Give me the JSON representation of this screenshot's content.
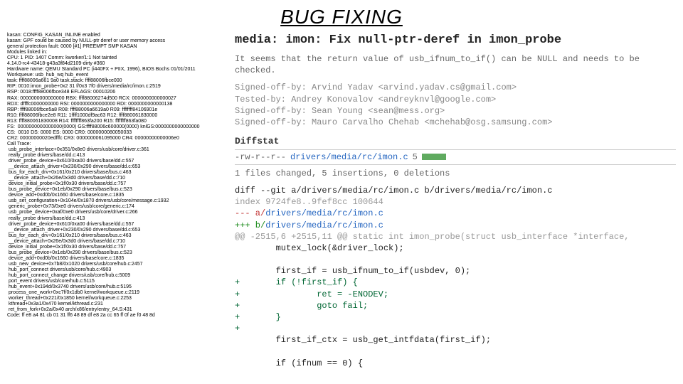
{
  "title": "BUG FIXING",
  "left_panel": "kasan: CONFIG_KASAN_INLINE enabled\nkasan: GPF could be caused by NULL-ptr deref or user memory access\ngeneral protection fault: 0000 [#1] PREEMPT SMP KASAN\nModules linked in:\nCPU: 1 PID: 1407 Comm: kworker/1:1 Not tainted\n4.14.0-rc4-43418-g43a3f84d2109-dirty #360\nHardware name: QEMU Standard PC (i440FX + PIIX, 1996), BIOS Bochs 01/01/2011\nWorkqueue: usb_hub_wq hub_event\ntask: ffff88006a661 9a0 task.stack: ffff88006fbce000\nRIP: 0010:imon_probe+0x2 31 f/0x3 7f0 drivers/media/rc/imon.c:2519\nRSP: 0018:ffff88006fbce348 EFLAGS: 00010206\nRAX: 0000000000000000 RBX: ffff88006274d500 RCX: 0000000000000027\nRDX: dffffc0000000000 RSI: 0000000000000000 RDI: 0000000000000138\nRBP: ffff88006fbce5a8 R08: ffff88006a6619a0 R09: ffffffff84106901e\nR10: ffff88006fbce2e8 R11: 1ffff1000df9ac63 R12: ffff880061830000\nR13: ffff880061830008 R14: ffffffff863fa200 R15: ffffffff863fa080\nFS:  0000000000000000(0000) GS:ffff88006c600000(0000) knlGS:0000000000000000\nCS:  0010 DS: 0000 ES: 0000 CR0: 0000000080050033\nCR2: 00000000020edfffc CR3: 0000000061095000 CR4: 00000000000006e0\nCall Trace:\n usb_probe_interface+0x351/0x8e0 drivers/usb/core/driver.c:361\n really_probe drivers/base/dd.c:413\n driver_probe_device+0x610/0xa00 drivers/base/dd.c:557\n __device_attach_driver+0x230/0x290 drivers/base/dd.c:653\n bus_for_each_drv+0x161/0x210 drivers/base/bus.c:463\n __device_attach+0x26e/0x3d0 drivers/base/dd.c:710\n device_initial_probe+0x1f/0x30 drivers/base/dd.c:757\n bus_probe_device+0x1eb/0x290 drivers/base/bus.c:523\n device_add+0xd0b/0x1660 drivers/base/core.c:1835\n usb_set_configuration+0x104e/0x1870 drivers/usb/core/message.c:1932\n generic_probe+0x73/0xe0 drivers/usb/core/generic.c:174\n usb_probe_device+0xaf/0xe0 drivers/usb/core/driver.c:266\n really_probe drivers/base/dd.c:413\n driver_probe_device+0x610/0xa00 drivers/base/dd.c:557\n __device_attach_driver+0x230/0x290 drivers/base/dd.c:653\n bus_for_each_drv+0x161/0x210 drivers/base/bus.c:463\n __device_attach+0x26e/0x3d0 drivers/base/dd.c:710\n device_initial_probe+0x1f/0x30 drivers/base/dd.c:757\n bus_probe_device+0x1eb/0x290 drivers/base/bus.c:523\n device_add+0xd0b/0x1660 drivers/base/core.c:1835\n usb_new_device+0x7b8/0x1020 drivers/usb/core/hub.c:2457\n hub_port_connect drivers/usb/core/hub.c:4903\n hub_port_connect_change drivers/usb/core/hub.c:5009\n port_event drivers/usb/core/hub.c:5115\n hub_event+0x194d/0x3740 drivers/usb/core/hub.c:5195\n process_one_work+0xc7f/0x1db0 kernel/workqueue.c:2119\n worker_thread+0x221/0x1850 kernel/workqueue.c:2253\n kthread+0x3a1/0x470 kernel/kthread.c:231\n ret_from_fork+0x2a/0x40 arch/x86/entry/entry_64.S:431\nCode: ff e8 a4 81 cb 01 31 ff6 48 89 df e8 2a cc 65 ff 0f ae f0 48 8d",
  "right_panel": {
    "header": "media: imon: Fix null-ptr-deref in imon_probe",
    "paragraph": "It seems that the return value of usb_ifnum_to_if() can be NULL and needs to be checked.",
    "signed": "Signed-off-by: Arvind Yadav <arvind.yadav.cs@gmail.com>\nTested-by: Andrey Konovalov <andreyknvl@google.com>\nSigned-off-by: Sean Young <sean@mess.org>\nSigned-off-by: Mauro Carvalho Chehab <mchehab@osg.samsung.com>",
    "diffstat_label": "Diffstat",
    "file_perm": "-rw-r--r--",
    "file_path": "drivers/media/rc/imon.c",
    "file_count": "5",
    "summary": "1 files changed, 5 insertions, 0 deletions",
    "diff": {
      "l1": "diff --git a/drivers/media/rc/imon.c b/drivers/media/rc/imon.c",
      "l2": "index 9724fe8..9fef8cc 100644",
      "l3a": "--- a/",
      "l3b": "drivers/media/rc/imon.c",
      "l4a": "+++ b/",
      "l4b": "drivers/media/rc/imon.c",
      "l5": "@@ -2515,6 +2515,11 @@ static int imon_probe(struct usb_interface *interface,",
      "l6": "        mutex_lock(&driver_lock);",
      "l7": "",
      "l8": "        first_if = usb_ifnum_to_if(usbdev, 0);",
      "p1": "+       if (!first_if) {",
      "p2": "+               ret = -ENODEV;",
      "p3": "+               goto fail;",
      "p4": "+       }",
      "p5": "+",
      "l9": "        first_if_ctx = usb_get_intfdata(first_if);",
      "l10": "",
      "l11": "        if (ifnum == 0) {"
    }
  }
}
